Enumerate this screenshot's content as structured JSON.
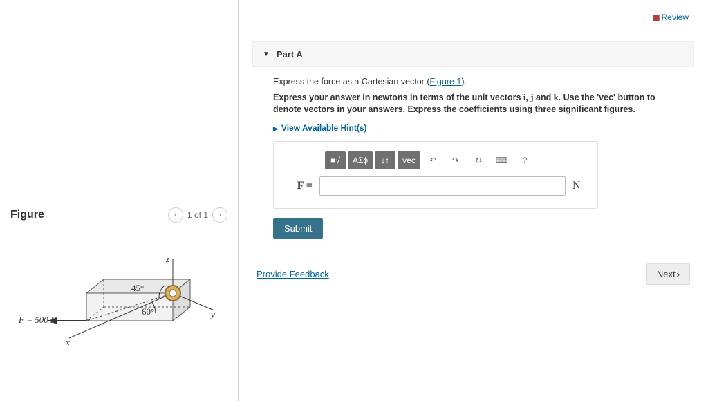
{
  "review_label": "Review",
  "part_label": "Part A",
  "prompt_pre": "Express the force as a Cartesian vector (",
  "figure_link": "Figure 1",
  "prompt_post": ").",
  "instruction_1": "Express your answer in newtons in terms of the unit vectors ",
  "vec_i": "i",
  "vec_j": "j",
  "vec_k": "k",
  "instruction_2": ". Use the 'vec' button to denote vectors in your answers. Express the coefficients using three significant figures.",
  "hints_label": "View Available Hint(s)",
  "toolbar": {
    "templates": "■√",
    "greek": "ΑΣϕ",
    "subsup": "↓↑",
    "vec": "vec",
    "undo": "↶",
    "redo": "↷",
    "reset": "↻",
    "keyboard": "⌨",
    "help": "?"
  },
  "lhs": "F =",
  "unit": "N",
  "answer_value": "",
  "submit_label": "Submit",
  "feedback_label": "Provide Feedback",
  "next_label": "Next",
  "figure_heading": "Figure",
  "figure_counter": "1 of 1",
  "figure": {
    "force_label": "F = 500 N",
    "angle1": "45°",
    "angle2": "60°",
    "axis_x": "x",
    "axis_y": "y",
    "axis_z": "z"
  }
}
